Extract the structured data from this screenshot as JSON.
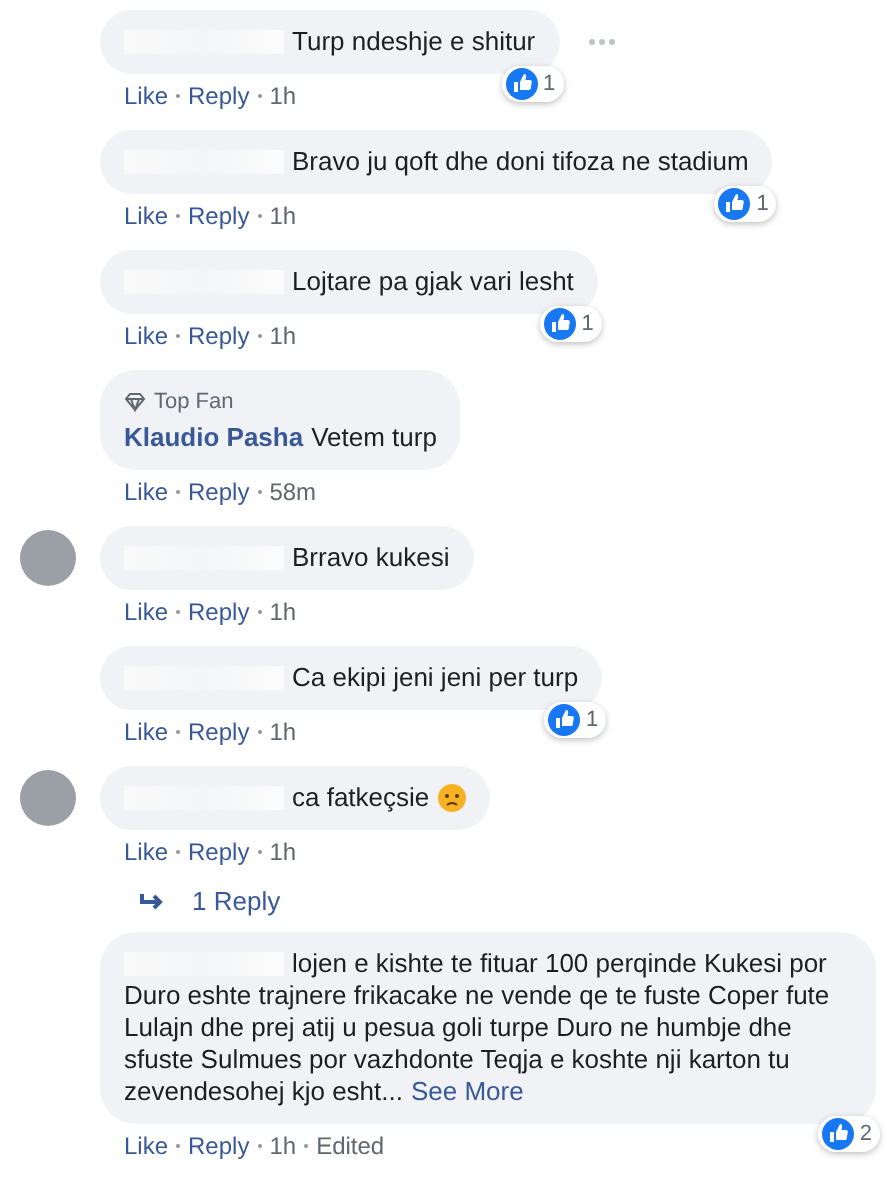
{
  "comments": [
    {
      "avatar": false,
      "name_hidden": true,
      "text": "Turp ndeshje e shitur",
      "more": true,
      "reactions": "1",
      "actions": [
        "Like",
        "Reply"
      ],
      "time": "1h"
    },
    {
      "avatar": false,
      "name_hidden": true,
      "text": "Bravo ju qoft dhe doni tifoza ne stadium",
      "reactions": "1",
      "actions": [
        "Like",
        "Reply"
      ],
      "time": "1h"
    },
    {
      "avatar": false,
      "name_hidden": true,
      "text": "Lojtare pa gjak vari lesht",
      "reactions": "1",
      "actions": [
        "Like",
        "Reply"
      ],
      "time": "1h"
    },
    {
      "avatar": false,
      "badge": "Top Fan",
      "author": "Klaudio Pasha",
      "text": "Vetem turp",
      "actions": [
        "Like",
        "Reply"
      ],
      "time": "58m"
    },
    {
      "avatar": true,
      "name_hidden": true,
      "text": "Brravo kukesi",
      "actions": [
        "Like",
        "Reply"
      ],
      "time": "1h"
    },
    {
      "avatar": false,
      "name_hidden": true,
      "text": "Ca ekipi jeni jeni per turp",
      "reactions": "1",
      "actions": [
        "Like",
        "Reply"
      ],
      "time": "1h"
    },
    {
      "avatar": true,
      "name_hidden": true,
      "text": "ca fatkeçsie",
      "sad_emoji": true,
      "actions": [
        "Like",
        "Reply"
      ],
      "time": "1h",
      "replies": "1 Reply"
    },
    {
      "avatar": false,
      "name_hidden": true,
      "text": "lojen e kishte te fituar 100 perqinde Kukesi por Duro eshte trajnere frikacake ne vende qe te fuste Coper fute Lulajn dhe prej atij u pesua goli turpe Duro ne humbje dhe sfuste Sulmues por vazhdonte Teqja e koshte nji karton tu zevendesohej kjo esht...",
      "see_more": "See More",
      "reactions": "2",
      "actions": [
        "Like",
        "Reply"
      ],
      "time": "1h",
      "edited": "Edited"
    }
  ]
}
